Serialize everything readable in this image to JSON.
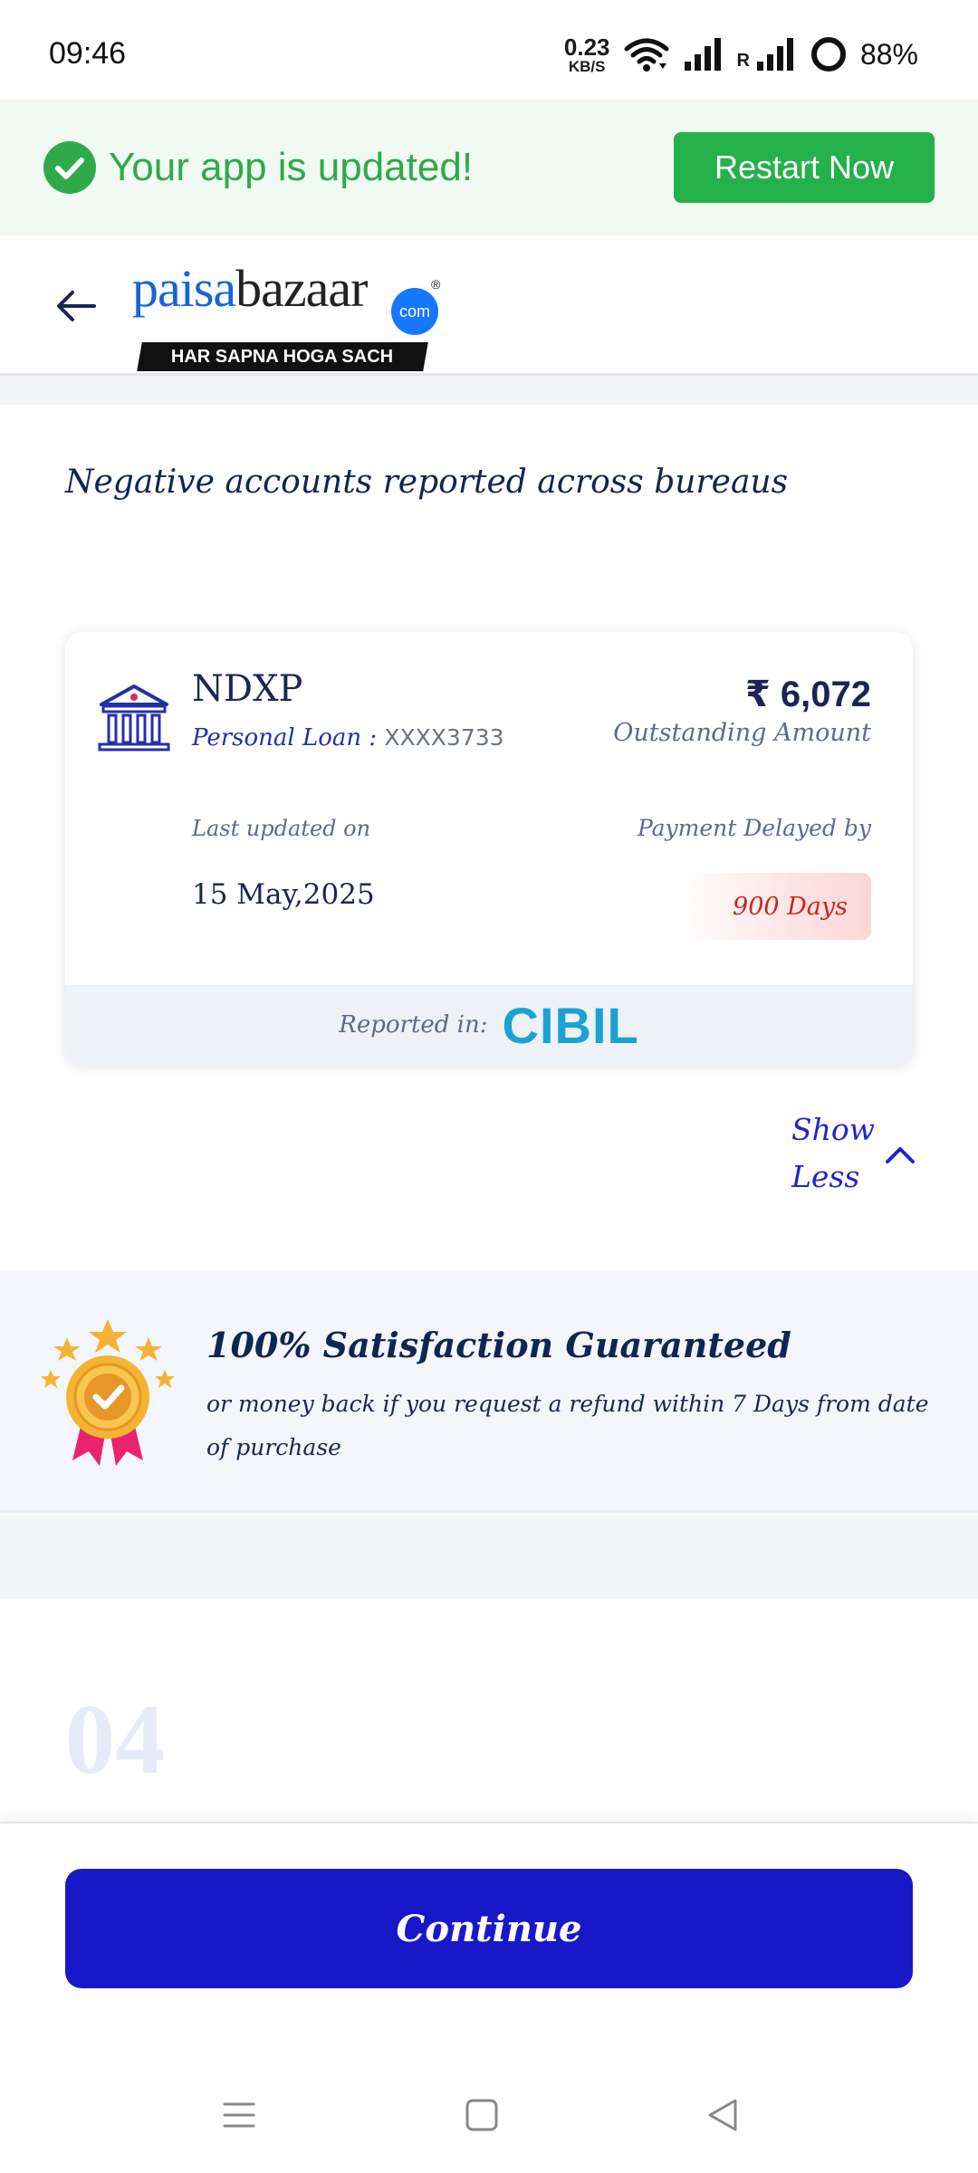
{
  "status_bar": {
    "time": "09:46",
    "net_speed_value": "0.23",
    "net_speed_unit": "KB/S",
    "roaming": "R",
    "battery": "88%"
  },
  "update_banner": {
    "message": "Your app is updated!",
    "button_label": "Restart Now"
  },
  "header": {
    "logo_part1": "paisa",
    "logo_part2": "bazaar",
    "logo_badge": "com",
    "logo_reg": "®",
    "logo_tagline": "HAR SAPNA HOGA SACH"
  },
  "section": {
    "title": "Negative accounts reported across bureaus"
  },
  "account": {
    "lender": "NDXP",
    "loan_type": "Personal Loan :",
    "account_number": "XXXX3733",
    "amount": "₹ 6,072",
    "amount_label": "Outstanding Amount",
    "last_updated_label": "Last updated on",
    "last_updated_value": "15 May,2025",
    "delay_label": "Payment Delayed by",
    "delay_value": "900 Days",
    "reported_label": "Reported in:",
    "bureau": "CIBIL"
  },
  "show_less": {
    "label": "Show Less"
  },
  "satisfaction": {
    "title": "100% Satisfaction Guaranteed",
    "subtitle": "or money back if you request a refund within 7 Days from date of purchase"
  },
  "next_step": {
    "number": "04"
  },
  "cta": {
    "label": "Continue"
  },
  "colors": {
    "primary": "#1818c9",
    "success": "#24b04a",
    "danger": "#c6281e",
    "navy": "#0f2552",
    "cibil": "#1aa2d6"
  }
}
